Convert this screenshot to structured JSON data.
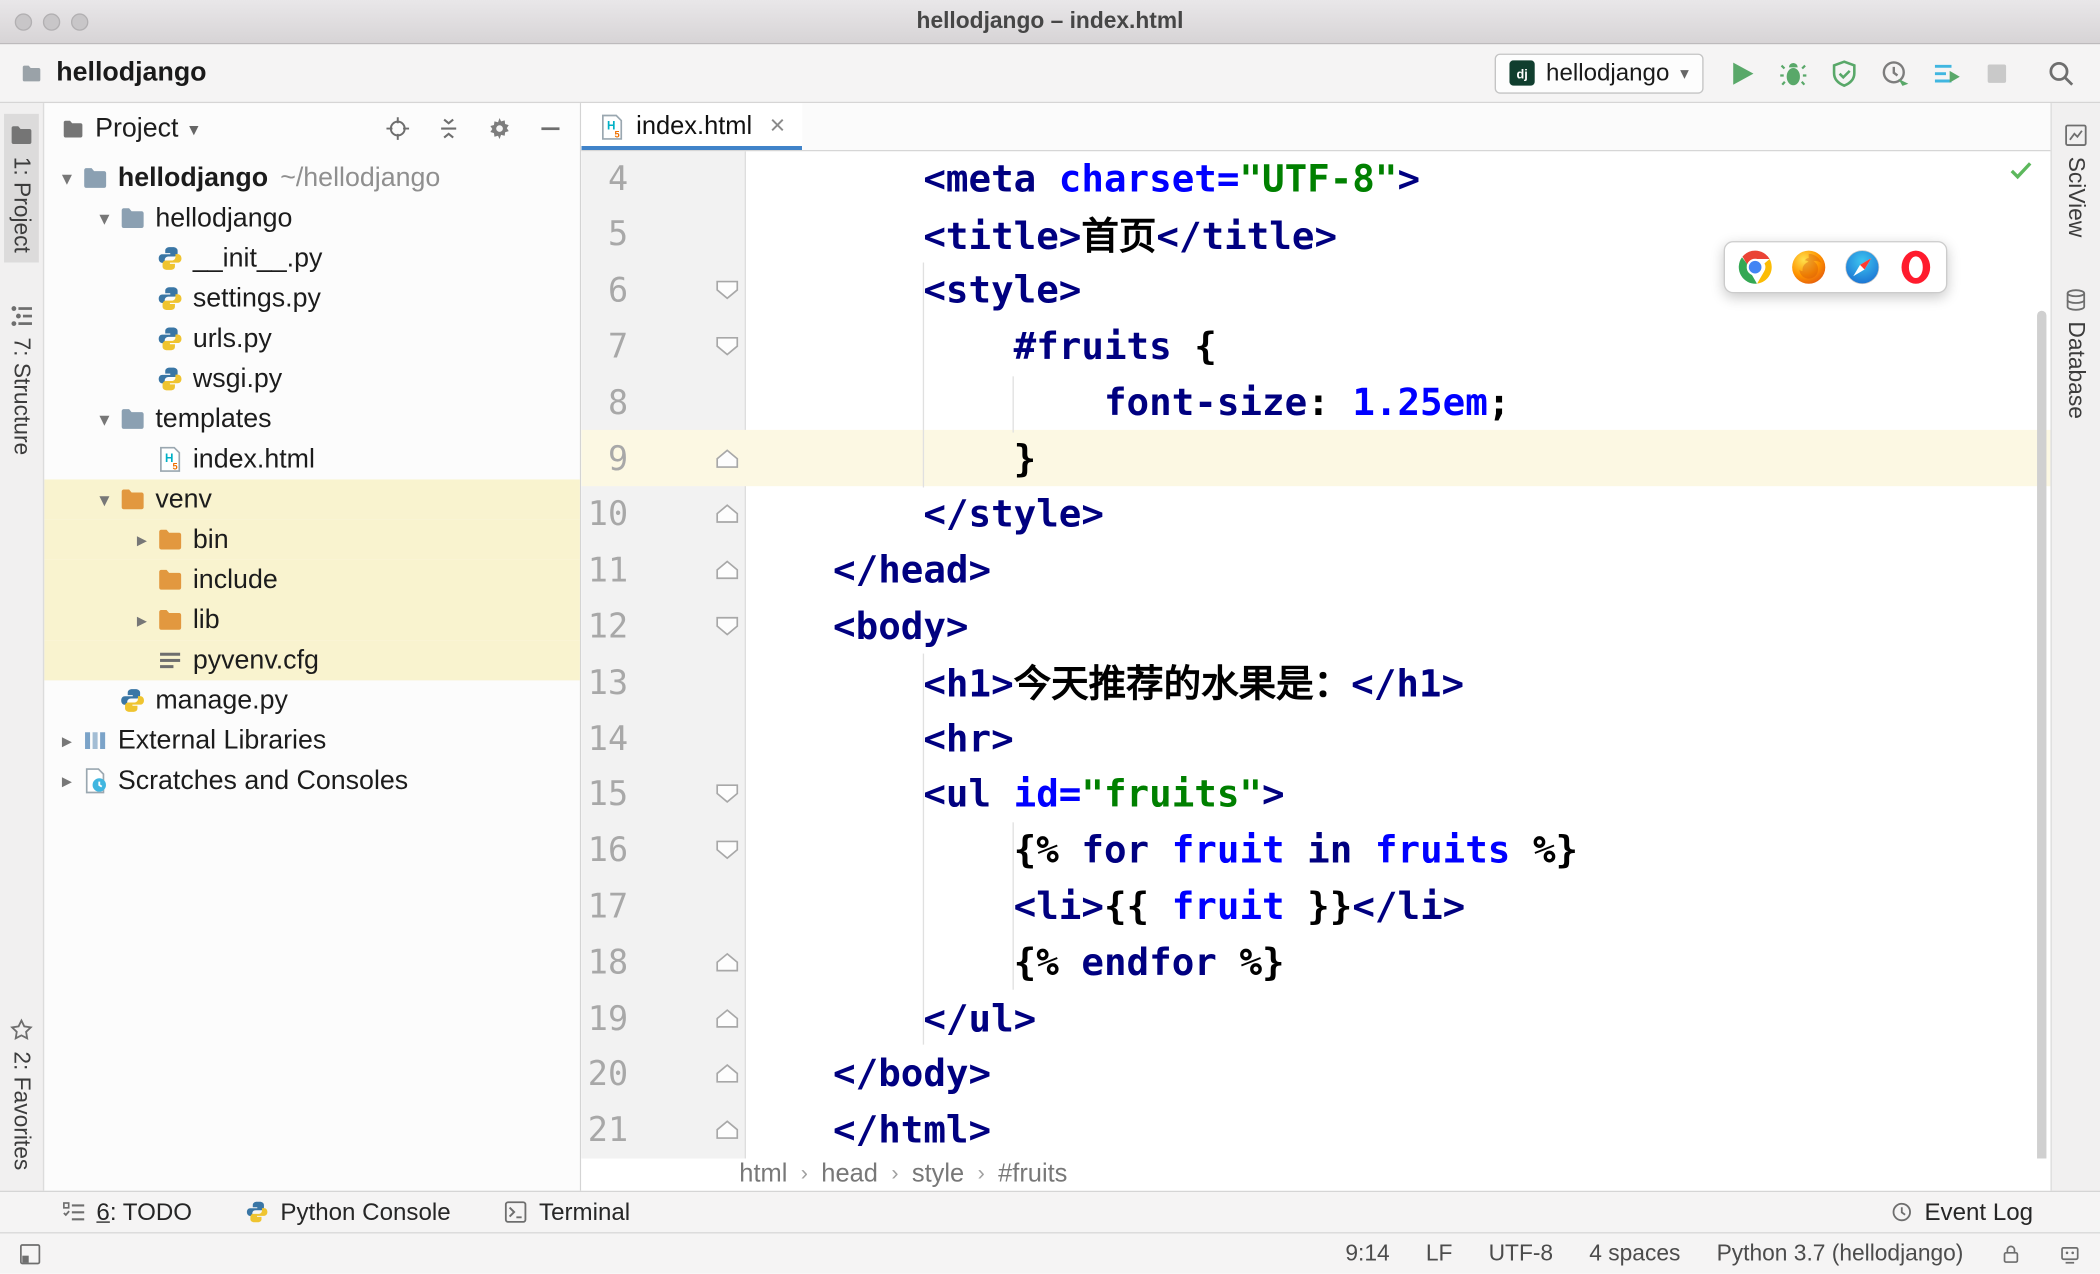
{
  "window": {
    "title": "hellodjango – index.html"
  },
  "colors": {
    "tab_accent": "#4083c9",
    "run_green": "#59a869",
    "caret_line": "#fcf8e3",
    "excluded_band": "#f9f3cf",
    "tag": "#000080",
    "attribute": "#0000ff",
    "string": "#008000"
  },
  "toolbar": {
    "project_breadcrumb": "hellodjango",
    "folder_icon": "folder-gray-icon",
    "run_config": {
      "icon": "django-icon",
      "label": "hellodjango"
    },
    "buttons": [
      {
        "name": "run-button",
        "icon": "run-icon"
      },
      {
        "name": "debug-button",
        "icon": "debug-icon"
      },
      {
        "name": "coverage-button",
        "icon": "coverage-icon"
      },
      {
        "name": "profiler-button",
        "icon": "profiler-icon"
      },
      {
        "name": "concurrency-button",
        "icon": "concurrency-icon"
      },
      {
        "name": "stop-button",
        "icon": "stop-icon"
      }
    ],
    "search_icon": "search-icon"
  },
  "left_stripe": [
    {
      "label": "1: Project",
      "icon": "project-tool-icon",
      "active": true,
      "anchor": "top"
    },
    {
      "label": "7: Structure",
      "icon": "structure-tool-icon",
      "anchor": "top"
    },
    {
      "label": "2: Favorites",
      "icon": "favorites-tool-icon",
      "anchor": "bottom"
    }
  ],
  "right_stripe": [
    {
      "label": "SciView",
      "icon": "sciview-tool-icon"
    },
    {
      "label": "Database",
      "icon": "database-tool-icon"
    }
  ],
  "project_panel": {
    "title": "Project",
    "title_icon": "project-tool-icon",
    "header_icons": [
      {
        "name": "locate-file-button",
        "icon": "locate-icon"
      },
      {
        "name": "collapse-all-button",
        "icon": "collapse-all-icon"
      },
      {
        "name": "settings-button",
        "icon": "gear-icon"
      },
      {
        "name": "hide-panel-button",
        "icon": "minus-icon"
      }
    ],
    "tree": [
      {
        "label": "hellodjango",
        "suffix": " ~/hellodjango",
        "level": 0,
        "icon": "folder-icon",
        "arrow": "down",
        "bold": true
      },
      {
        "label": "hellodjango",
        "level": 1,
        "icon": "folder-icon",
        "arrow": "down"
      },
      {
        "label": "__init__.py",
        "level": 2,
        "icon": "python-file-icon"
      },
      {
        "label": "settings.py",
        "level": 2,
        "icon": "python-file-icon"
      },
      {
        "label": "urls.py",
        "level": 2,
        "icon": "python-file-icon"
      },
      {
        "label": "wsgi.py",
        "level": 2,
        "icon": "python-file-icon"
      },
      {
        "label": "templates",
        "level": 1,
        "icon": "folder-icon",
        "arrow": "down"
      },
      {
        "label": "index.html",
        "level": 2,
        "icon": "html-file-icon"
      },
      {
        "label": "venv",
        "level": 1,
        "icon": "folder-excluded-icon",
        "arrow": "down",
        "highlight": true
      },
      {
        "label": "bin",
        "level": 2,
        "icon": "folder-excluded-icon",
        "arrow": "right",
        "highlight": true
      },
      {
        "label": "include",
        "level": 2,
        "icon": "folder-excluded-icon",
        "highlight": true
      },
      {
        "label": "lib",
        "level": 2,
        "icon": "folder-excluded-icon",
        "arrow": "right",
        "highlight": true
      },
      {
        "label": "pyvenv.cfg",
        "level": 2,
        "icon": "text-file-icon",
        "highlight": true
      },
      {
        "label": "manage.py",
        "level": 1,
        "icon": "python-file-icon"
      },
      {
        "label": "External Libraries",
        "level": 0,
        "icon": "libraries-icon",
        "arrow": "right"
      },
      {
        "label": "Scratches and Consoles",
        "level": 0,
        "icon": "scratches-icon",
        "arrow": "right"
      }
    ]
  },
  "editor": {
    "tab": {
      "label": "index.html",
      "icon": "html-file-icon",
      "close_glyph": "×"
    },
    "caret_line": 9,
    "inspection_icon": "inspections-ok-icon",
    "breadcrumbs": [
      "html",
      "head",
      "style",
      "#fruits"
    ],
    "browser_icons": [
      "chrome-icon",
      "firefox-icon",
      "safari-icon",
      "opera-icon"
    ],
    "lines": [
      {
        "num": 4,
        "segments": [
          [
            "    <meta ",
            "tag"
          ],
          [
            "charset=",
            "attr"
          ],
          [
            "\"UTF-8\"",
            "str"
          ],
          [
            ">",
            "tag"
          ]
        ]
      },
      {
        "num": 5,
        "segments": [
          [
            "    <title>",
            "tag"
          ],
          [
            "首页",
            "txt"
          ],
          [
            "</title>",
            "tag"
          ]
        ]
      },
      {
        "num": 6,
        "fold": "down",
        "segments": [
          [
            "    <style>",
            "tag"
          ]
        ]
      },
      {
        "num": 7,
        "fold": "down",
        "segments": [
          [
            "        ",
            "txt"
          ],
          [
            "#fruits ",
            "sel"
          ],
          [
            "{",
            "txt"
          ]
        ]
      },
      {
        "num": 8,
        "segments": [
          [
            "            ",
            "txt"
          ],
          [
            "font-size",
            "prop"
          ],
          [
            ": ",
            "txt"
          ],
          [
            "1.25em",
            "val"
          ],
          [
            ";",
            "txt"
          ]
        ]
      },
      {
        "num": 9,
        "fold": "up",
        "segments": [
          [
            "        }",
            "txt"
          ]
        ]
      },
      {
        "num": 10,
        "fold": "up",
        "segments": [
          [
            "    </style>",
            "tag"
          ]
        ]
      },
      {
        "num": 11,
        "fold": "up",
        "segments": [
          [
            "</head>",
            "tag"
          ]
        ]
      },
      {
        "num": 12,
        "fold": "down",
        "segments": [
          [
            "<body>",
            "tag"
          ]
        ]
      },
      {
        "num": 13,
        "segments": [
          [
            "    <h1>",
            "tag"
          ],
          [
            "今天推荐的水果是：",
            "txt"
          ],
          [
            "</h1>",
            "tag"
          ]
        ]
      },
      {
        "num": 14,
        "segments": [
          [
            "    <hr>",
            "tag"
          ]
        ]
      },
      {
        "num": 15,
        "fold": "down",
        "segments": [
          [
            "    <ul ",
            "tag"
          ],
          [
            "id=",
            "attr"
          ],
          [
            "\"fruits\"",
            "str"
          ],
          [
            ">",
            "tag"
          ]
        ]
      },
      {
        "num": 16,
        "fold": "down",
        "segments": [
          [
            "        {% ",
            "brace"
          ],
          [
            "for ",
            "kw"
          ],
          [
            "fruit ",
            "var"
          ],
          [
            "in ",
            "kw"
          ],
          [
            "fruits ",
            "var"
          ],
          [
            "%}",
            "brace"
          ]
        ]
      },
      {
        "num": 17,
        "segments": [
          [
            "        <li>",
            "tag"
          ],
          [
            "{{ ",
            "brace"
          ],
          [
            "fruit ",
            "var"
          ],
          [
            "}}",
            "brace"
          ],
          [
            "</li>",
            "tag"
          ]
        ]
      },
      {
        "num": 18,
        "fold": "up",
        "segments": [
          [
            "        {% ",
            "brace"
          ],
          [
            "endfor ",
            "kw"
          ],
          [
            "%}",
            "brace"
          ]
        ]
      },
      {
        "num": 19,
        "fold": "up",
        "segments": [
          [
            "    </ul>",
            "tag"
          ]
        ]
      },
      {
        "num": 20,
        "fold": "up",
        "segments": [
          [
            "</body>",
            "tag"
          ]
        ]
      },
      {
        "num": 21,
        "fold": "up",
        "segments": [
          [
            "</html>",
            "tag"
          ]
        ]
      }
    ]
  },
  "bottom_bar": {
    "left": [
      {
        "icon": "todo-icon",
        "mnemonic": "6",
        "label": ": TODO"
      },
      {
        "icon": "python-console-icon",
        "label": "Python Console"
      },
      {
        "icon": "terminal-icon",
        "label": "Terminal"
      }
    ],
    "right": [
      {
        "icon": "event-log-icon",
        "label": "Event Log"
      }
    ]
  },
  "status_bar": {
    "toggle_icon": "toolwindows-toggle-icon",
    "items": [
      "9:14",
      "LF",
      "UTF-8",
      "4 spaces",
      "Python 3.7 (hellodjango)"
    ],
    "icons": [
      "lock-icon",
      "hector-icon"
    ]
  }
}
